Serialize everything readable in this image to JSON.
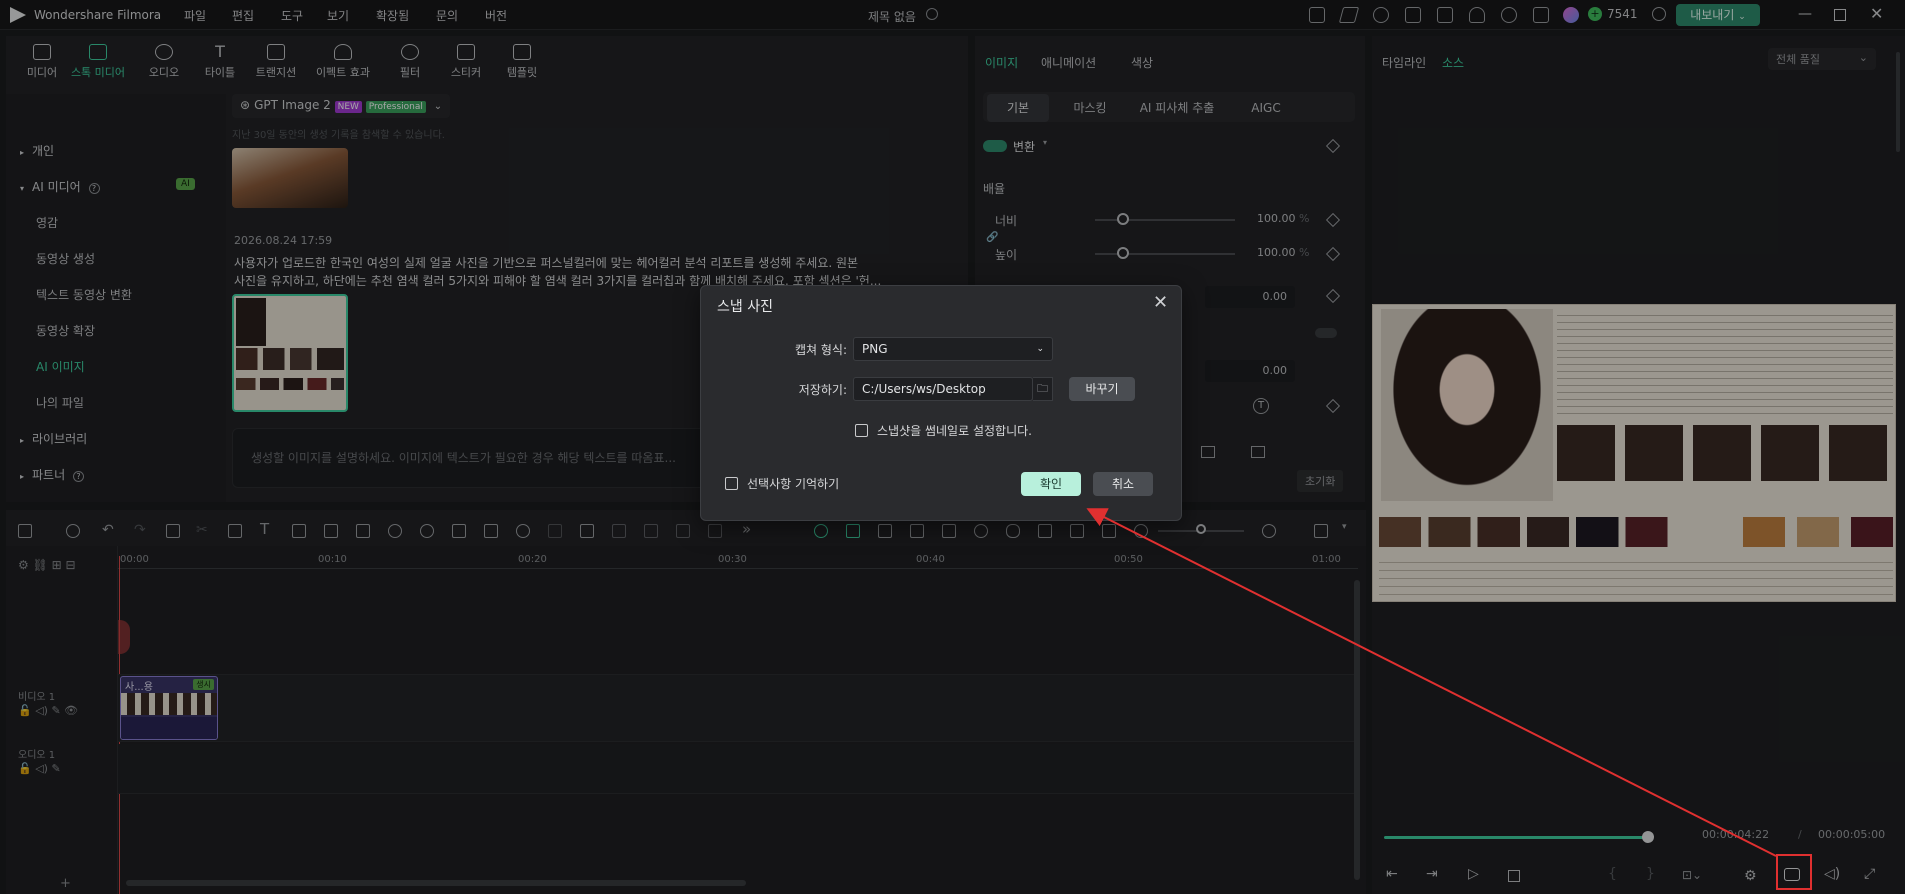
{
  "app": {
    "name": "Wondershare Filmora",
    "menu": [
      "파일",
      "편집",
      "도구",
      "보기",
      "확장됨",
      "문의",
      "버전"
    ],
    "project_title": "제목 없음",
    "credits": "7541",
    "export_label": "내보내기"
  },
  "media": {
    "tabs": [
      "미디어",
      "스톡 미디어",
      "오디오",
      "타이틀",
      "트랜지션",
      "이펙트 효과",
      "필터",
      "스티커",
      "템플릿"
    ],
    "active_tab": "스톡 미디어",
    "sidebar": {
      "personal": "개인",
      "ai_media": "AI 미디어",
      "ai_badge": "AI",
      "items": [
        "영감",
        "동영상 생성",
        "텍스트 동영상 변환",
        "동영상 확장",
        "AI 이미지",
        "나의 파일"
      ],
      "library": "라이브러리",
      "partner": "파트너"
    },
    "model": "GPT Image 2",
    "badge_new": "NEW",
    "badge_pro": "Professional",
    "hint": "지난 30일 동안의 생성 기록을 참색할 수 있습니다.",
    "timestamp": "2026.08.24 17:59",
    "prompt_line1": "사용자가 업로드한 한국인 여성의 실제 얼굴 사진을 기반으로 퍼스널컬러에 맞는 헤어컬러 분석 리포트를 생성해 주세요. 원본",
    "prompt_line2": "사진을 유지하고, 하단에는 추천 염색 컬러 5가지와 피해야 할 염색 컬러 3가지를 컬러칩과 함께 배치해 주세요. 포함 섹션은 '헌...",
    "input_placeholder": "생성할 이미지를 설명하세요. 이미지에 텍스트가 필요한 경우 해당 텍스트를 따옴표..."
  },
  "props": {
    "tabs": [
      "이미지",
      "애니메이션",
      "색상"
    ],
    "subtabs": [
      "기본",
      "마스킹",
      "AI 피사체 추출",
      "AIGC"
    ],
    "transform": "변환",
    "scale": "배율",
    "width_label": "너비",
    "height_label": "높이",
    "width_value": "100.00",
    "height_value": "100.00",
    "unit": "%",
    "value_a": "0.00",
    "value_b": "0.00",
    "reset": "초기화"
  },
  "preview": {
    "tabs": [
      "타임라인",
      "소스"
    ],
    "quality": "전체 품질",
    "current_time": "00:00:04:22",
    "total_time": "00:00:05:00",
    "progress": 0.96
  },
  "timeline": {
    "ruler": [
      "00:00",
      "00:10",
      "00:20",
      "00:30",
      "00:40",
      "00:50",
      "01:00"
    ],
    "video_track": "비디오 1",
    "audio_track": "오디오 1",
    "clip_label": "사...용",
    "clip_badge": "생시"
  },
  "dialog": {
    "title": "스냅 사진",
    "format_label": "캡쳐 형식:",
    "format_value": "PNG",
    "save_label": "저장하기:",
    "save_path": "C:/Users/ws/Desktop",
    "change_button": "바꾸기",
    "thumbnail_option": "스냅샷을 썸네일로 설정합니다.",
    "remember_option": "선택사항 기억하기",
    "ok_button": "확인",
    "cancel_button": "취소"
  },
  "colors": {
    "accent": "#3fd2a2",
    "annotation": "#e03030"
  }
}
